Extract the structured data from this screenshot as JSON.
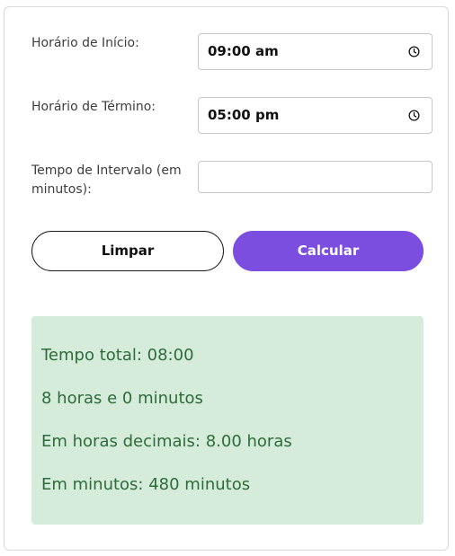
{
  "form": {
    "start_label": "Horário de Início:",
    "start_value": "09:00 am",
    "end_label": "Horário de Término:",
    "end_value": "05:00 pm",
    "break_label": "Tempo de Intervalo (em minutos):",
    "break_value": ""
  },
  "buttons": {
    "clear_label": "Limpar",
    "calculate_label": "Calcular"
  },
  "result": {
    "total_time": "Tempo total: 08:00",
    "hours_minutes": "8 horas e 0 minutos",
    "decimal_hours": "Em horas decimais: 8.00 horas",
    "minutes": "Em minutos: 480 minutos"
  },
  "icons": {
    "time_picker": "clock-icon"
  },
  "colors": {
    "accent": "#7b4ee0",
    "result_background": "#d6ecdb",
    "result_text": "#2d6b3a"
  }
}
